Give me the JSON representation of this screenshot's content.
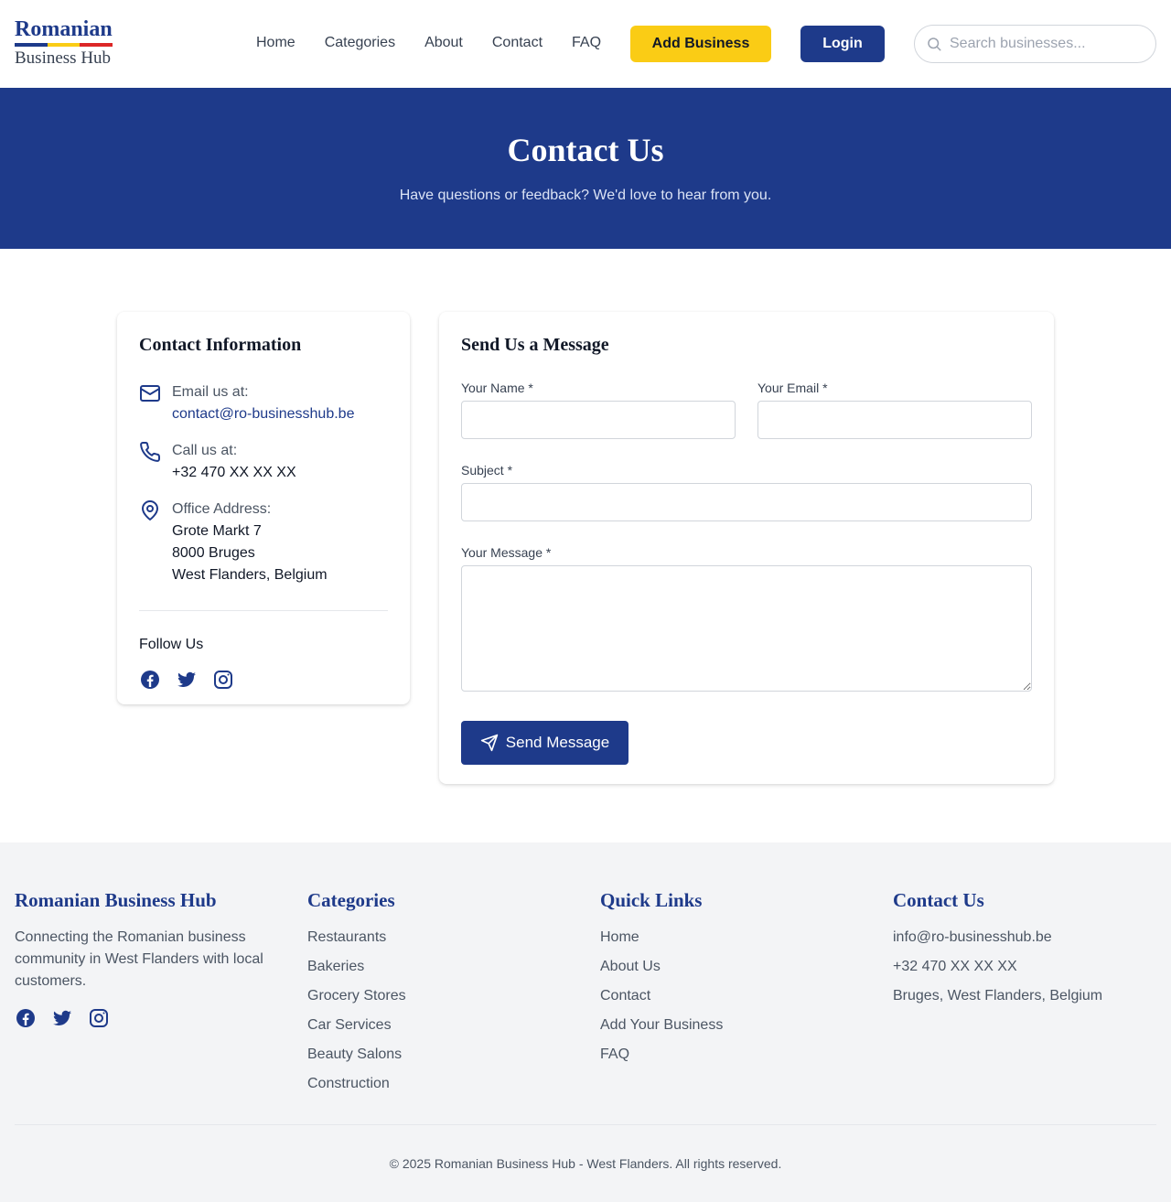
{
  "brand": {
    "title": "Romanian",
    "subtitle": "Business Hub",
    "flag_colors": [
      "#1e3a8a",
      "#facc15",
      "#dc2626"
    ]
  },
  "nav": {
    "items": [
      "Home",
      "Categories",
      "About",
      "Contact",
      "FAQ"
    ],
    "add_business": "Add Business",
    "login": "Login",
    "search_placeholder": "Search businesses..."
  },
  "hero": {
    "title": "Contact Us",
    "subtitle": "Have questions or feedback? We'd love to hear from you."
  },
  "contact_info": {
    "title": "Contact Information",
    "email_label": "Email us at:",
    "email": "contact@ro-businesshub.be",
    "phone_label": "Call us at:",
    "phone": "+32 470 XX XX XX",
    "address_label": "Office Address:",
    "address_lines": [
      "Grote Markt 7",
      "8000 Bruges",
      "West Flanders, Belgium"
    ],
    "follow": "Follow Us",
    "socials": [
      "facebook-icon",
      "twitter-icon",
      "instagram-icon"
    ]
  },
  "form": {
    "title": "Send Us a Message",
    "name_label": "Your Name *",
    "name_value": "",
    "email_label": "Your Email *",
    "email_value": "",
    "subject_label": "Subject *",
    "subject_value": "",
    "message_label": "Your Message *",
    "message_value": "",
    "submit": "Send Message"
  },
  "footer": {
    "about": {
      "title": "Romanian Business Hub",
      "desc": "Connecting the Romanian business community in West Flanders with local customers."
    },
    "categories": {
      "title": "Categories",
      "items": [
        "Restaurants",
        "Bakeries",
        "Grocery Stores",
        "Car Services",
        "Beauty Salons",
        "Construction"
      ]
    },
    "quick_links": {
      "title": "Quick Links",
      "items": [
        "Home",
        "About Us",
        "Contact",
        "Add Your Business",
        "FAQ"
      ]
    },
    "contact": {
      "title": "Contact Us",
      "items": [
        "info@ro-businesshub.be",
        "+32 470 XX XX XX",
        "Bruges, West Flanders, Belgium"
      ]
    },
    "copyright": "© 2025 Romanian Business Hub - West Flanders. All rights reserved."
  },
  "colors": {
    "primary": "#1e3a8a",
    "accent": "#facc15",
    "footer_bg": "#f3f4f6"
  }
}
